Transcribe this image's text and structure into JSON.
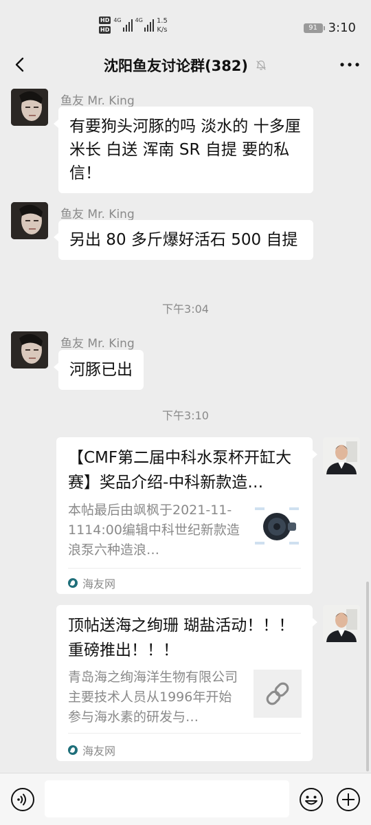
{
  "status_bar": {
    "hd_top": "HD",
    "hd_bottom": "HD",
    "net1": "4G",
    "net2": "4G",
    "speed_value": "1.5",
    "speed_unit": "K/s",
    "battery": "91",
    "time": "3:10"
  },
  "header": {
    "title": "沈阳鱼友讨论群(382)"
  },
  "messages": [
    {
      "sender": "鱼友 Mr. King",
      "text": "有要狗头河豚的吗  淡水的   十多厘米长   白送    浑南 SR 自提  要的私信！"
    },
    {
      "sender": "鱼友 Mr. King",
      "text": "另出 80 多斤爆好活石  500 自提"
    },
    {
      "sender": "鱼友 Mr. King",
      "text": "河豚已出"
    }
  ],
  "time_dividers": [
    "下午3:04",
    "下午3:10"
  ],
  "cards": [
    {
      "title": "【CMF第二届中科水泵杯开缸大赛】奖品介绍-中科新款造…",
      "description": "本帖最后由飒枫于2021-11-1114:00编辑中科世纪新款造浪泵六种造浪…",
      "source": "海友网",
      "thumb_icon": "pump-thumbnail"
    },
    {
      "title": "顶帖送海之绚珊  瑚盐活动！！！  重磅推出！！！",
      "description": "青岛海之绚海洋生物有限公司主要技术人员从1996年开始参与海水素的研发与…",
      "source": "海友网",
      "thumb_icon": "link-icon"
    }
  ],
  "input_bar": {
    "text_value": ""
  },
  "colors": {
    "background": "#ededed",
    "bubble": "#ffffff",
    "meta_text": "#8a8a8a"
  }
}
